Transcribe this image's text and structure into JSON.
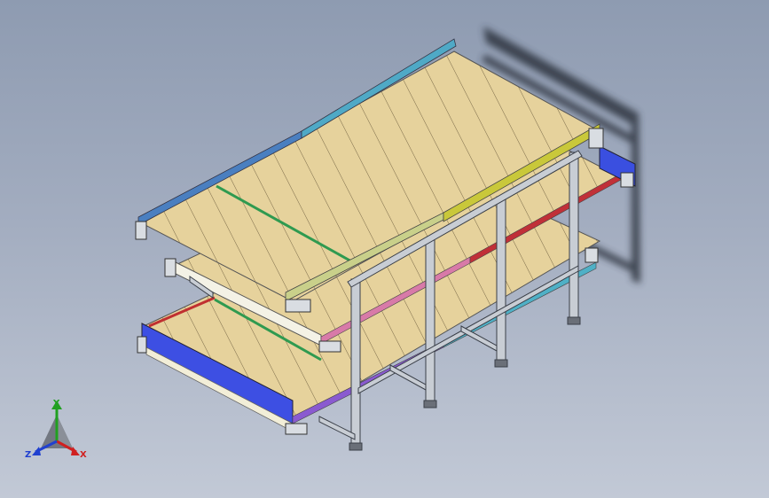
{
  "triad": {
    "x_label": "X",
    "y_label": "Y",
    "z_label": "Z"
  },
  "colors": {
    "background_top": "#8e9bb1",
    "background_bottom": "#c2c9d6",
    "belt": "#e6d29c",
    "belt_lines": "#6b5a3a",
    "frame": "#c8cdd4",
    "rail_blue": "#4a7fc0",
    "rail_cyan": "#4fa9c6",
    "rail_yellow": "#c9c83a",
    "rail_red": "#c0303a",
    "rail_pink": "#d87aa8",
    "rail_purple": "#8a5ad0",
    "rail_green": "#3a9a5a",
    "end_blue": "#3a4fe0",
    "axis_x": "#d02020",
    "axis_y": "#20a020",
    "axis_z": "#2040d0"
  }
}
